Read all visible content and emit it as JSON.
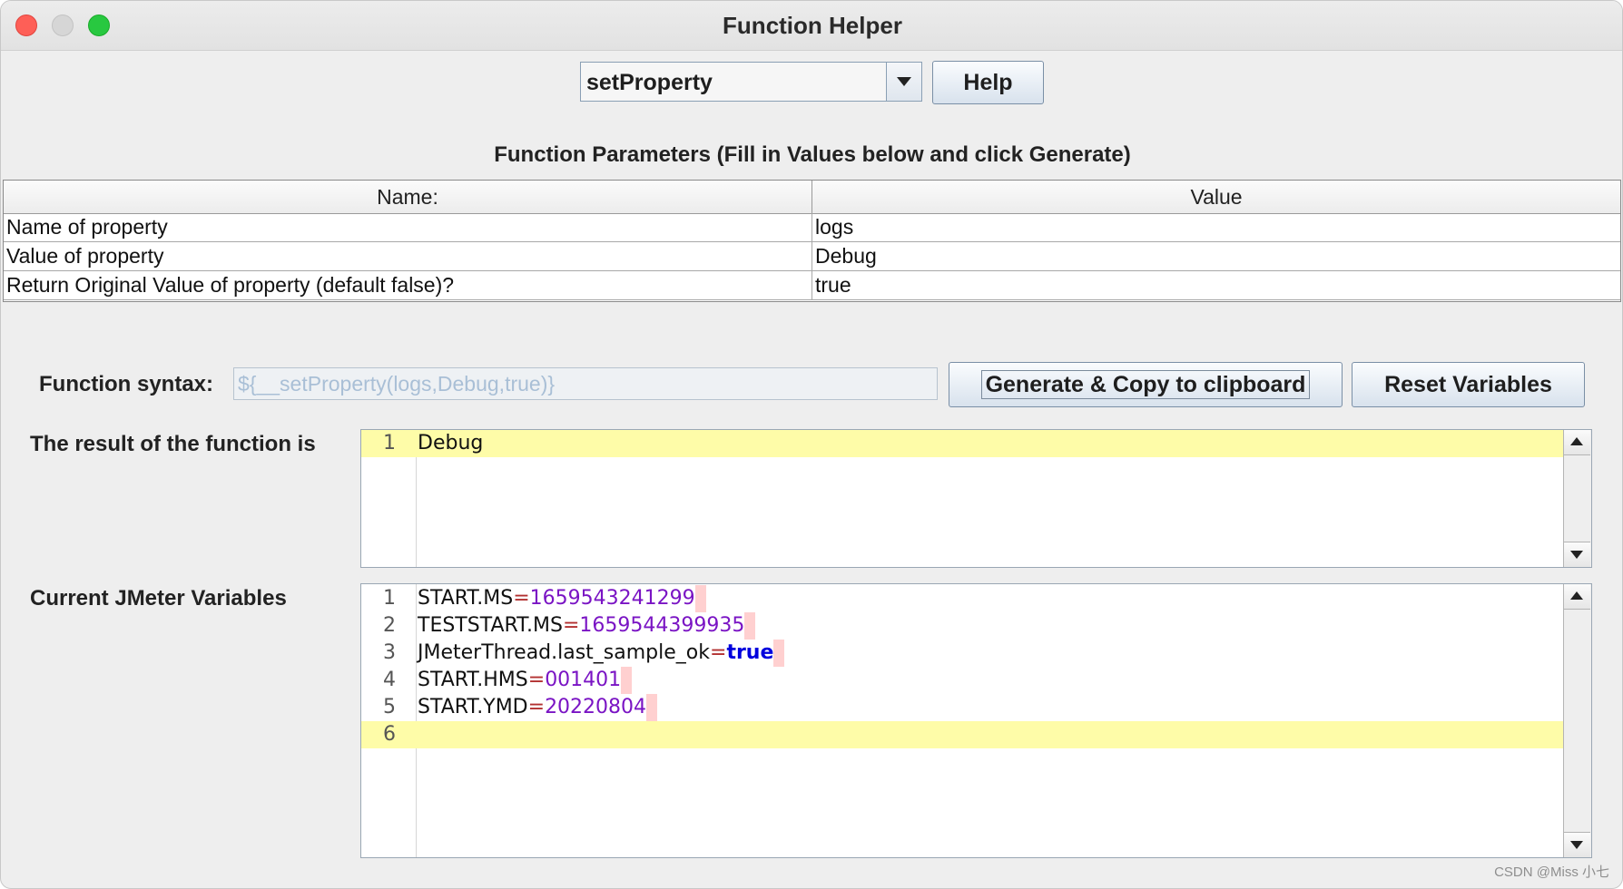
{
  "window": {
    "title": "Function Helper"
  },
  "function_select": {
    "selected": "setProperty",
    "help_label": "Help"
  },
  "parameters": {
    "heading": "Function Parameters (Fill in Values below and click Generate)",
    "columns": [
      "Name:",
      "Value"
    ],
    "rows": [
      {
        "name": "Name of property",
        "value": "logs"
      },
      {
        "name": "Value of property",
        "value": "Debug"
      },
      {
        "name": "Return Original Value of property (default false)?",
        "value": "true"
      }
    ]
  },
  "syntax": {
    "label": "Function syntax:",
    "value": "${__setProperty(logs,Debug,true)}",
    "generate_label": "Generate & Copy to clipboard",
    "reset_label": "Reset Variables"
  },
  "result": {
    "label": "The result of the function is",
    "lines": [
      {
        "number": "1",
        "text": "Debug"
      }
    ]
  },
  "variables": {
    "label": "Current JMeter Variables",
    "lines": [
      {
        "number": "1",
        "key": "START.MS",
        "eq": "=",
        "value": "1659543241299"
      },
      {
        "number": "2",
        "key": "TESTSTART.MS",
        "eq": "=",
        "value": "1659544399935"
      },
      {
        "number": "3",
        "key": "JMeterThread.last_sample_ok",
        "eq": "=",
        "value": "true"
      },
      {
        "number": "4",
        "key": "START.HMS",
        "eq": "=",
        "value": "001401"
      },
      {
        "number": "5",
        "key": "START.YMD",
        "eq": "=",
        "value": "20220804"
      },
      {
        "number": "6",
        "key": "",
        "eq": "",
        "value": ""
      }
    ]
  },
  "watermark": "CSDN @Miss 小七",
  "colors": {
    "current_line": "#fefca8",
    "number_value": "#7a14c4",
    "keyword": "#0000dd",
    "equals": "#b23030"
  },
  "icons": {
    "combo_arrow": "chevron-down-icon",
    "scroll_up": "arrow-up-icon",
    "scroll_down": "arrow-down-icon"
  }
}
